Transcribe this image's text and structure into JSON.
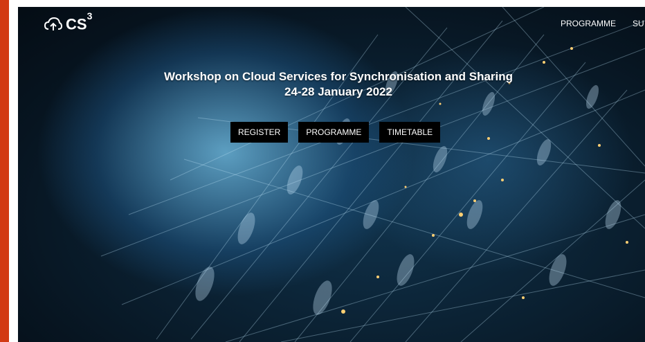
{
  "brand": {
    "logo_icon": "cloud-upload-icon",
    "name": "CS",
    "superscript": "3"
  },
  "nav": {
    "items": [
      {
        "label": "PROGRAMME"
      },
      {
        "label": "SU"
      }
    ]
  },
  "hero": {
    "title": "Workshop on Cloud Services for Synchronisation and Sharing",
    "dates": "24-28 January 2022",
    "buttons": [
      {
        "label": "REGISTER"
      },
      {
        "label": "PROGRAMME"
      },
      {
        "label": "TIMETABLE"
      }
    ]
  },
  "colors": {
    "accent_bar": "#d23a13",
    "button_bg": "#000000",
    "text": "#ffffff"
  }
}
